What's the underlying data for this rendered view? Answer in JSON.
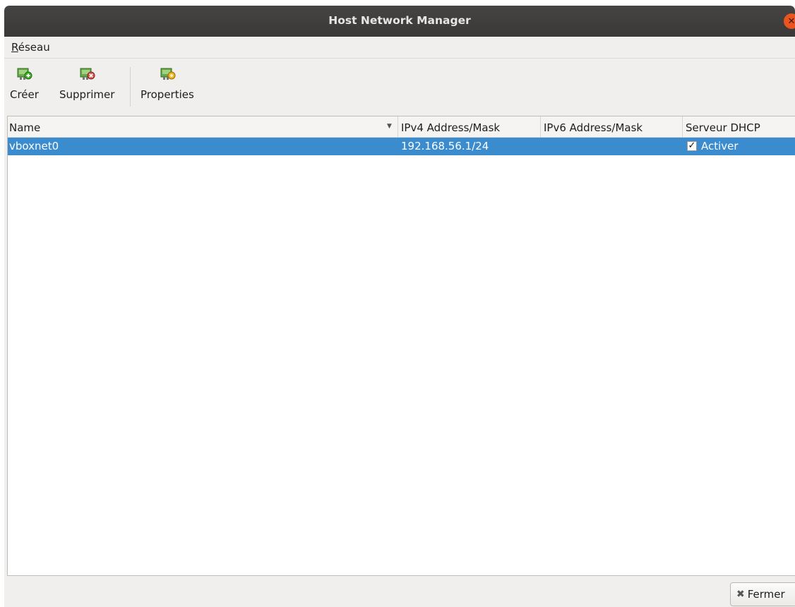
{
  "window": {
    "title": "Host Network Manager"
  },
  "menubar": {
    "items": [
      {
        "mnemonic": "R",
        "rest": "éseau"
      }
    ]
  },
  "toolbar": {
    "create_label": "Créer",
    "remove_label": "Supprimer",
    "properties_label": "Properties"
  },
  "table": {
    "columns": [
      "Name",
      "IPv4 Address/Mask",
      "IPv6 Address/Mask",
      "Serveur DHCP"
    ],
    "rows": [
      {
        "name": "vboxnet0",
        "ipv4": "192.168.56.1/24",
        "ipv6": "",
        "dhcp_label": "Activer",
        "dhcp_checked": true,
        "selected": true
      }
    ]
  },
  "footer": {
    "close_label": "Fermer"
  },
  "colors": {
    "selection": "#3a8ccf",
    "close_button": "#e95420",
    "titlebar": "#3c3b37"
  }
}
